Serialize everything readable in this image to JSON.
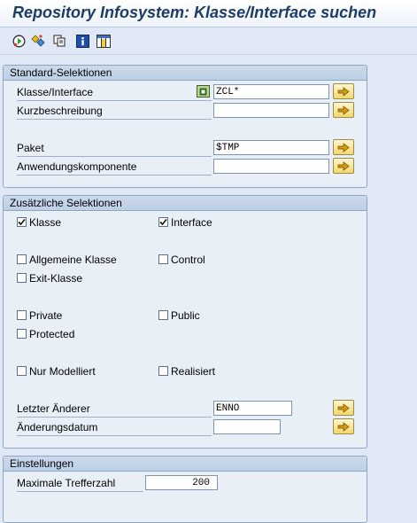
{
  "window": {
    "title": "Repository Infosystem: Klasse/Interface suchen"
  },
  "toolbar": {
    "icons": [
      "execute-icon",
      "selection-options-icon",
      "copy-icon",
      "info-icon",
      "columns-icon"
    ]
  },
  "standard": {
    "heading": "Standard-Selektionen",
    "klasse_label": "Klasse/Interface",
    "klasse_value": "ZCL*",
    "kurz_label": "Kurzbeschreibung",
    "kurz_value": "",
    "paket_label": "Paket",
    "paket_value": "$TMP",
    "anw_label": "Anwendungskomponente",
    "anw_value": ""
  },
  "zusatz": {
    "heading": "Zusätzliche Selektionen",
    "klasse": {
      "label": "Klasse",
      "checked": true
    },
    "interface": {
      "label": "Interface",
      "checked": true
    },
    "allgemeine": {
      "label": "Allgemeine Klasse",
      "checked": false
    },
    "control": {
      "label": "Control",
      "checked": false
    },
    "exit": {
      "label": "Exit-Klasse",
      "checked": false
    },
    "private": {
      "label": "Private",
      "checked": false
    },
    "public": {
      "label": "Public",
      "checked": false
    },
    "protected": {
      "label": "Protected",
      "checked": false
    },
    "modelliert": {
      "label": "Nur Modelliert",
      "checked": false
    },
    "realisiert": {
      "label": "Realisiert",
      "checked": false
    },
    "aenderer_label": "Letzter Änderer",
    "aenderer_value": "ENNO",
    "datum_label": "Änderungsdatum",
    "datum_value": ""
  },
  "settings": {
    "heading": "Einstellungen",
    "max_label": "Maximale Trefferzahl",
    "max_value": "200"
  },
  "colors": {
    "title": "#1d3c66",
    "background": "#dfe8f4",
    "group_header": "#c5d6ea",
    "multisel_button": "#f3d76a"
  }
}
